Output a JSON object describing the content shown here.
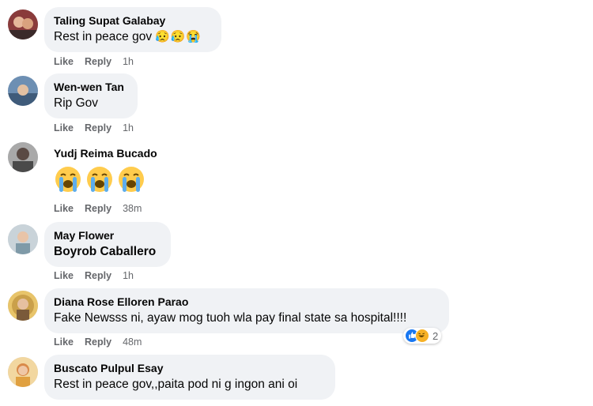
{
  "comments": [
    {
      "author": "Taling Supat Galabay",
      "text": "Rest in peace gov",
      "emoji": "😥😥😭",
      "like": "Like",
      "reply": "Reply",
      "time": "1h"
    },
    {
      "author": "Wen-wen Tan",
      "text": "Rip Gov",
      "like": "Like",
      "reply": "Reply",
      "time": "1h"
    },
    {
      "author": "Yudj Reima Bucado",
      "emoji": "😭😭😭",
      "like": "Like",
      "reply": "Reply",
      "time": "38m"
    },
    {
      "author": "May Flower",
      "text": "Boyrob Caballero",
      "like": "Like",
      "reply": "Reply",
      "time": "1h"
    },
    {
      "author": "Diana Rose Elloren Parao",
      "text": "Fake Newsss ni, ayaw mog tuoh wla pay final state sa hospital!!!!",
      "like": "Like",
      "reply": "Reply",
      "time": "48m",
      "reaction_count": "2",
      "reaction_icons": [
        "like-icon",
        "haha-icon"
      ]
    },
    {
      "author": "Buscato Pulpul Esay",
      "text": "Rest in peace gov,,paita pod ni g ingon ani oi"
    }
  ],
  "colors": {
    "bubble": "#f0f2f5",
    "meta": "#65676b",
    "like_blue": "#1877f2"
  }
}
